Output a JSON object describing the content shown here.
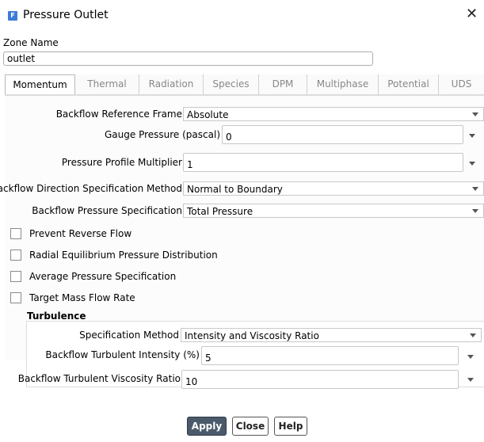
{
  "window": {
    "title": "Pressure Outlet",
    "app_icon_letter": "F"
  },
  "zone": {
    "label": "Zone Name",
    "value": "outlet"
  },
  "tabs": [
    {
      "label": "Momentum"
    },
    {
      "label": "Thermal"
    },
    {
      "label": "Radiation"
    },
    {
      "label": "Species"
    },
    {
      "label": "DPM"
    },
    {
      "label": "Multiphase"
    },
    {
      "label": "Potential"
    },
    {
      "label": "UDS"
    }
  ],
  "momentum": {
    "backflow_reference_frame": {
      "label": "Backflow Reference Frame",
      "value": "Absolute"
    },
    "gauge_pressure": {
      "label": "Gauge Pressure (pascal)",
      "value": "0"
    },
    "pressure_profile_multiplier": {
      "label": "Pressure Profile Multiplier",
      "value": "1"
    },
    "backflow_direction_method": {
      "label": "Backflow Direction Specification Method",
      "value": "Normal to Boundary"
    },
    "backflow_pressure_spec": {
      "label": "Backflow Pressure Specification",
      "value": "Total Pressure"
    },
    "checkboxes": {
      "prevent_reverse_flow": "Prevent Reverse Flow",
      "radial_equilibrium": "Radial Equilibrium Pressure Distribution",
      "average_pressure": "Average Pressure Specification",
      "target_mass_flow": "Target Mass Flow Rate"
    }
  },
  "turbulence": {
    "title": "Turbulence",
    "specification_method": {
      "label": "Specification Method",
      "value": "Intensity and Viscosity Ratio"
    },
    "turbulent_intensity": {
      "label": "Backflow Turbulent Intensity (%)",
      "value": "5"
    },
    "viscosity_ratio": {
      "label": "Backflow Turbulent Viscosity Ratio",
      "value": "10"
    }
  },
  "buttons": {
    "apply": "Apply",
    "close": "Close",
    "help": "Help"
  },
  "colors": {
    "accent": "#3d7bd9",
    "apply_bg": "#4a5a6b"
  }
}
